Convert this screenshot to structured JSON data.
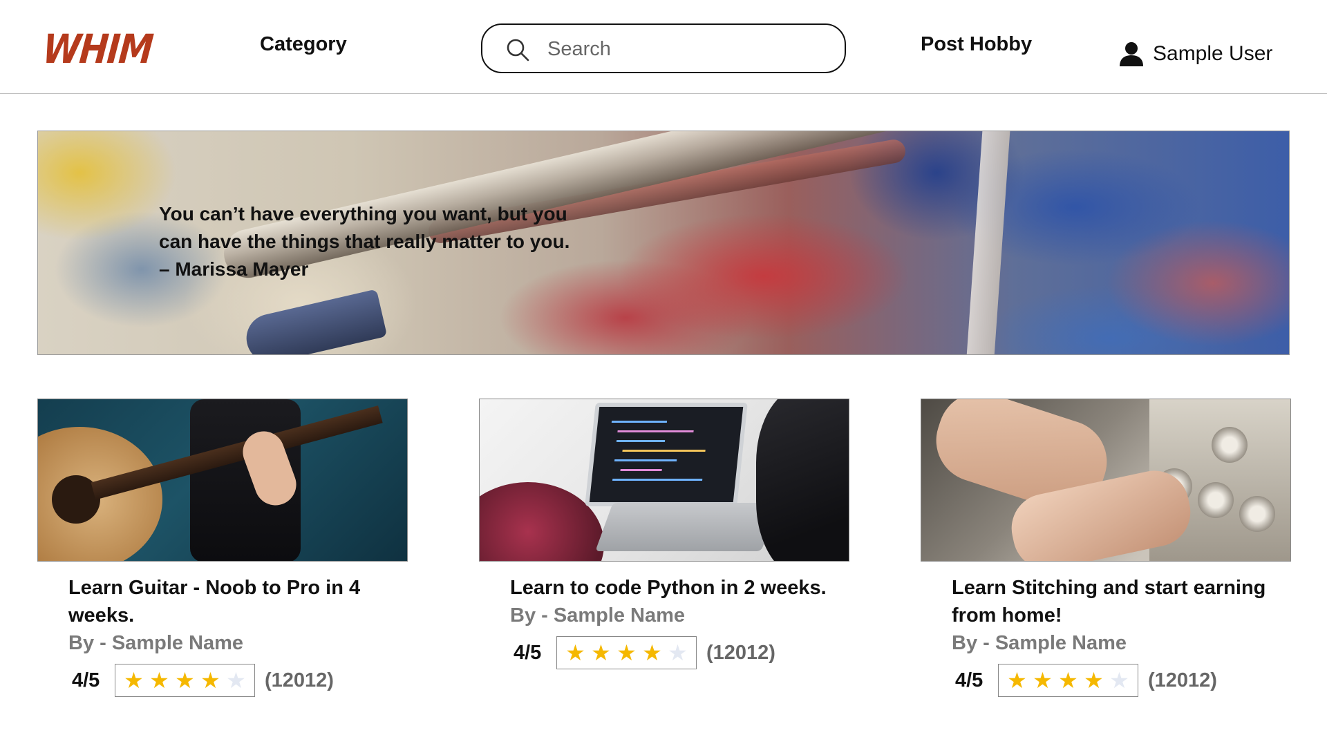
{
  "header": {
    "logo_text": "WHIM",
    "nav_category": "Category",
    "search": {
      "placeholder": "Search",
      "value": ""
    },
    "nav_post_hobby": "Post Hobby",
    "user_name": "Sample User"
  },
  "banner": {
    "quote": "You can’t have everything you want, but you can have the things that really matter to you. – Marissa Mayer"
  },
  "cards": [
    {
      "image": "guitar-photo",
      "title": "Learn Guitar - Noob to Pro in 4 weeks.",
      "author": "By - Sample Name",
      "rating_text": "4/5",
      "rating_value": 4,
      "rating_max": 5,
      "review_count": "(12012)"
    },
    {
      "image": "coding-photo",
      "title": "Learn to code Python in 2 weeks.",
      "author": "By - Sample Name",
      "rating_text": "4/5",
      "rating_value": 4,
      "rating_max": 5,
      "review_count": "(12012)"
    },
    {
      "image": "stitching-photo",
      "title": "Learn Stitching and start earning from home!",
      "author": "By - Sample Name",
      "rating_text": "4/5",
      "rating_value": 4,
      "rating_max": 5,
      "review_count": "(12012)"
    }
  ],
  "colors": {
    "logo": "#b53a1c",
    "star_on": "#f5b800",
    "star_off": "#e3e8f2",
    "author_text": "#7a7a7a"
  },
  "icons": {
    "search": "search-icon",
    "user": "user-icon",
    "star": "star-icon"
  }
}
